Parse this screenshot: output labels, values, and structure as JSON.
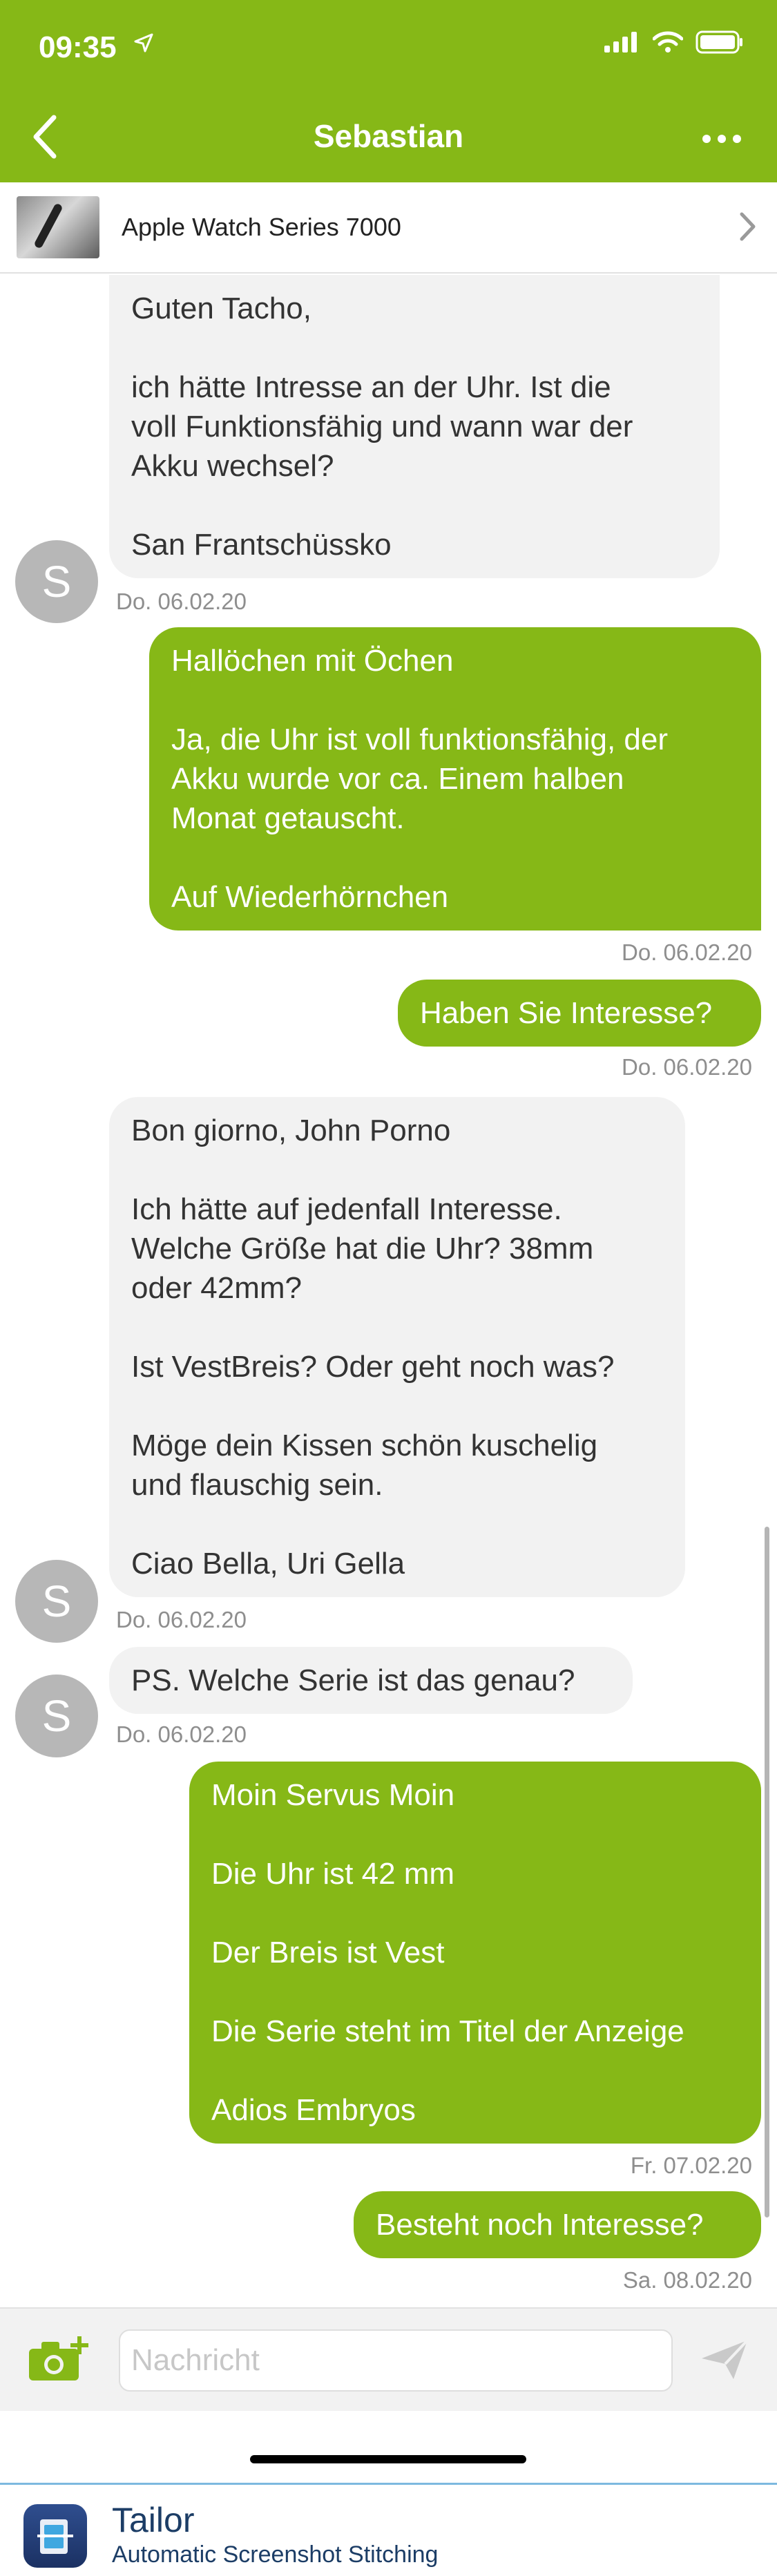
{
  "status_bar": {
    "time": "09:35"
  },
  "header": {
    "title": "Sebastian"
  },
  "listing": {
    "title": "Apple Watch Series 7000"
  },
  "messages": [
    {
      "from": "them",
      "lines": [
        "Guten Tacho,",
        "",
        "ich hätte Intresse an der Uhr. Ist die",
        "voll Funktionsfähig und wann war der",
        "Akku wechsel?",
        "",
        "San Frantschüssko"
      ],
      "time": "Do. 06.02.20",
      "avatar": "S"
    },
    {
      "from": "me",
      "lines": [
        "Hallöchen mit Öchen",
        "",
        "Ja, die Uhr ist voll funktionsfähig, der",
        "Akku wurde vor ca. Einem halben",
        "Monat getauscht.",
        "",
        "Auf Wiederhörnchen"
      ],
      "time": "Do. 06.02.20"
    },
    {
      "from": "me",
      "lines": [
        "Haben Sie Interesse?"
      ],
      "time": "Do. 06.02.20"
    },
    {
      "from": "them",
      "lines": [
        "Bon giorno, John Porno",
        "",
        "Ich hätte auf jedenfall Interesse.",
        "Welche Größe hat die Uhr? 38mm",
        "oder 42mm?",
        "",
        "Ist VestBreis? Oder geht noch was?",
        "",
        "Möge dein Kissen schön kuschelig",
        "und flauschig sein.",
        "",
        "Ciao Bella, Uri Gella"
      ],
      "time": "Do. 06.02.20",
      "avatar": "S"
    },
    {
      "from": "them",
      "lines": [
        "PS. Welche Serie ist das genau?"
      ],
      "time": "Do. 06.02.20",
      "avatar": "S"
    },
    {
      "from": "me",
      "lines": [
        "Moin Servus Moin",
        "",
        "Die Uhr ist 42 mm",
        "",
        "Der Breis ist Vest",
        "",
        "Die Serie steht im Titel der Anzeige",
        "",
        "Adios Embryos"
      ],
      "time": "Fr. 07.02.20"
    },
    {
      "from": "me",
      "lines": [
        "Besteht noch Interesse?"
      ],
      "time": "Sa. 08.02.20"
    }
  ],
  "composer": {
    "placeholder": "Nachricht"
  },
  "banner": {
    "app_name": "Tailor",
    "tagline": "Automatic Screenshot Stitching"
  },
  "colors": {
    "accent": "#86b817",
    "incoming_bubble": "#f2f2f2",
    "timestamp": "#8e8e8e",
    "avatar": "#b7b7b7"
  },
  "icons": {
    "back": "chevron-left-icon",
    "more": "ellipsis-icon",
    "camera": "camera-add-icon",
    "send": "send-icon"
  }
}
